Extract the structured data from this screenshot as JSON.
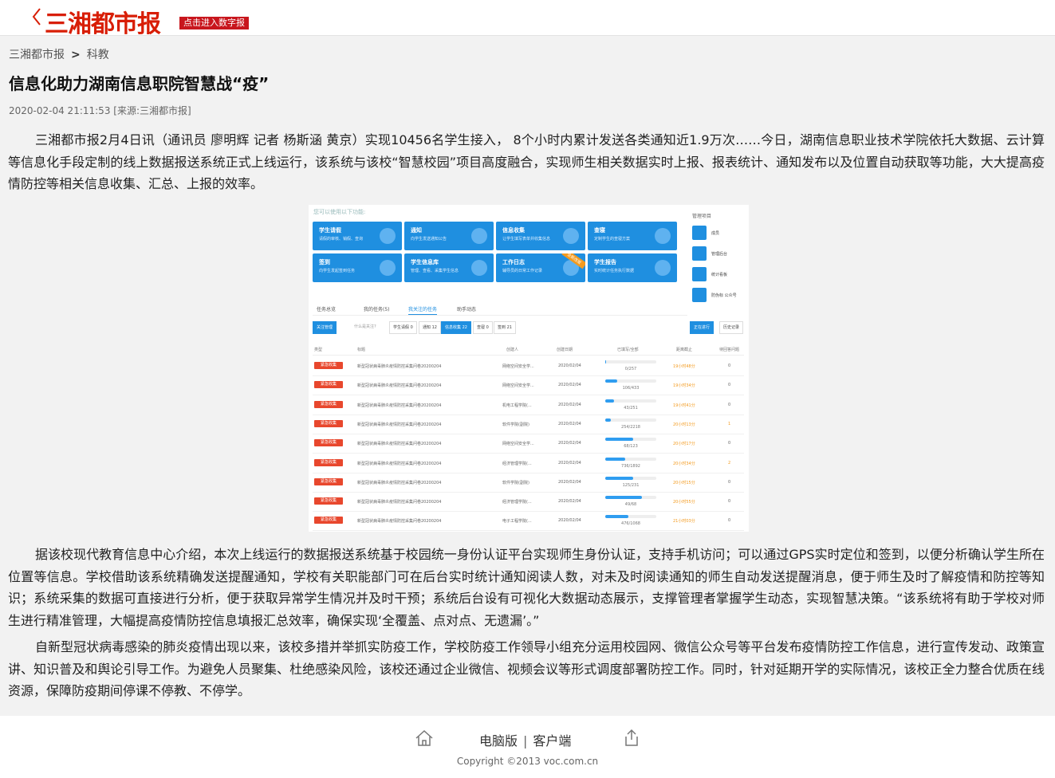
{
  "header": {
    "logo_text": "三湘都市报",
    "digital_label": "点击进入数字报"
  },
  "breadcrumb": {
    "home": "三湘都市报",
    "separator": ">",
    "section": "科教"
  },
  "article": {
    "title": "信息化助力湖南信息职院智慧战“疫”",
    "meta": "2020-02-04 21:11:53 [来源:三湘都市报]",
    "paragraphs": [
      "三湘都市报2月4日讯（通讯员 廖明辉 记者 杨斯涵 黄京）实现10456名学生接入， 8个小时内累计发送各类通知近1.9万次……今日，湖南信息职业技术学院依托大数据、云计算等信息化手段定制的线上数据报送系统正式上线运行，该系统与该校“智慧校园”项目高度融合，实现师生相关数据实时上报、报表统计、通知发布以及位置自动获取等功能，大大提高疫情防控等相关信息收集、汇总、上报的效率。",
      "据该校现代教育信息中心介绍，本次上线运行的数据报送系统基于校园统一身份认证平台实现师生身份认证，支持手机访问；可以通过GPS实时定位和签到，以便分析确认学生所在位置等信息。学校借助该系统精确发送提醒通知，学校有关职能部门可在后台实时统计通知阅读人数，对未及时阅读通知的师生自动发送提醒消息，便于师生及时了解疫情和防控等知识；系统采集的数据可直接进行分析，便于获取异常学生情况并及时干预；系统后台设有可视化大数据动态展示，支撑管理者掌握学生动态，实现智慧决策。“该系统将有助于学校对师生进行精准管理，大幅提高疫情防控信息填报汇总效率，确保实现‘全覆盖、点对点、无遗漏’。”",
      "自新型冠状病毒感染的肺炎疫情出现以来，该校多措并举抓实防疫工作，学校防疫工作领导小组充分运用校园网、微信公众号等平台发布疫情防控工作信息，进行宣传发动、政策宣讲、知识普及和舆论引导工作。为避免人员聚集、杜绝感染风险，该校还通过企业微信、视频会议等形式调度部署防控工作。同时，针对延期开学的实际情况，该校正全力整合优质在线资源，保障防疫期间停课不停教、不停学。"
    ]
  },
  "screenshot": {
    "hint": "您可以使用以下功能:",
    "cards": [
      {
        "title": "学生请假",
        "sub": "请假的审核、销假、查询"
      },
      {
        "title": "通知",
        "sub": "向学生发送通知公告"
      },
      {
        "title": "信息收集",
        "sub": "让学生填写表单并收集信息"
      },
      {
        "title": "查寝",
        "sub": "定制学生的查寝方案"
      },
      {
        "title": "签到",
        "sub": "向学生发起签到任务"
      },
      {
        "title": "学生信息库",
        "sub": "管理、查看、采集学生信息"
      },
      {
        "title": "工作日志",
        "sub": "辅导员的日常工作记录"
      },
      {
        "title": "学生报告",
        "sub": "实时统计任务执行数据"
      }
    ],
    "new_badge": "全新改版",
    "side_title": "管理项目",
    "side_items": [
      "成员",
      "管理后台",
      "统计看板",
      "防伪标 公众号"
    ],
    "tabs": [
      "任务总览",
      "我的任务(5)",
      "我关注的任务",
      "助手动态"
    ],
    "filters": [
      "关注管理",
      "什么是关注?",
      "学生请假 0",
      "通知 12",
      "信息收集 22",
      "查寝 0",
      "签到 21"
    ],
    "right_buttons": [
      "正在进行",
      "历史记录"
    ],
    "columns": [
      "类型",
      "标题",
      "创建人",
      "创建日期",
      "已填写/全部",
      "距离截止",
      "待回答问题"
    ],
    "tag_label": "紧急收集",
    "rows": [
      {
        "title": "新型冠状病毒肺炎疫情防控采集问卷20200204",
        "creator": "网络空间安全学...",
        "date": "2020/02/04",
        "progress": 0.0,
        "count": "0/257",
        "deadline": "19小时48分",
        "pending": "0"
      },
      {
        "title": "新型冠状病毒肺炎疫情防控采集问卷20200204",
        "creator": "网络空间安全学...",
        "date": "2020/02/04",
        "progress": 0.24,
        "count": "106/433",
        "deadline": "19小时34分",
        "pending": "0"
      },
      {
        "title": "新型冠状病毒肺炎疫情防控采集问卷20200204",
        "creator": "机电工程学院(...",
        "date": "2020/02/04",
        "progress": 0.17,
        "count": "43/251",
        "deadline": "19小时41分",
        "pending": "0"
      },
      {
        "title": "新型冠状病毒肺炎疫情防控采集问卷20200204",
        "creator": "软件学院(副院)",
        "date": "2020/02/04",
        "progress": 0.11,
        "count": "254/2218",
        "deadline": "20小时13分",
        "pending": "1"
      },
      {
        "title": "新型冠状病毒肺炎疫情防控采集问卷20200204",
        "creator": "网络空间安全学...",
        "date": "2020/02/04",
        "progress": 0.55,
        "count": "68/123",
        "deadline": "20小时17分",
        "pending": "0"
      },
      {
        "title": "新型冠状病毒肺炎疫情防控采集问卷20200204",
        "creator": "经济管理学院(...",
        "date": "2020/02/04",
        "progress": 0.39,
        "count": "736/1892",
        "deadline": "20小时34分",
        "pending": "2"
      },
      {
        "title": "新型冠状病毒肺炎疫情防控采集问卷20200204",
        "creator": "软件学院(副院)",
        "date": "2020/02/04",
        "progress": 0.54,
        "count": "125/231",
        "deadline": "20小时15分",
        "pending": "0"
      },
      {
        "title": "新型冠状病毒肺炎疫情防控采集问卷20200204",
        "creator": "经济管理学院(...",
        "date": "2020/02/04",
        "progress": 0.72,
        "count": "49/68",
        "deadline": "20小时55分",
        "pending": "0"
      },
      {
        "title": "新型冠状病毒肺炎疫情防控采集问卷20200204",
        "creator": "电子工程学院(...",
        "date": "2020/02/04",
        "progress": 0.45,
        "count": "476/1068",
        "deadline": "21小时03分",
        "pending": "0"
      }
    ]
  },
  "footer": {
    "desktop": "电脑版",
    "separator": "|",
    "client": "客户端",
    "copyright": "Copyright ©2013 voc.com.cn"
  },
  "colors": {
    "brand_red": "#d81e06",
    "accent_blue": "#1f8fe0",
    "tag_red": "#e8472d",
    "deadline_orange": "#f39a1e"
  }
}
